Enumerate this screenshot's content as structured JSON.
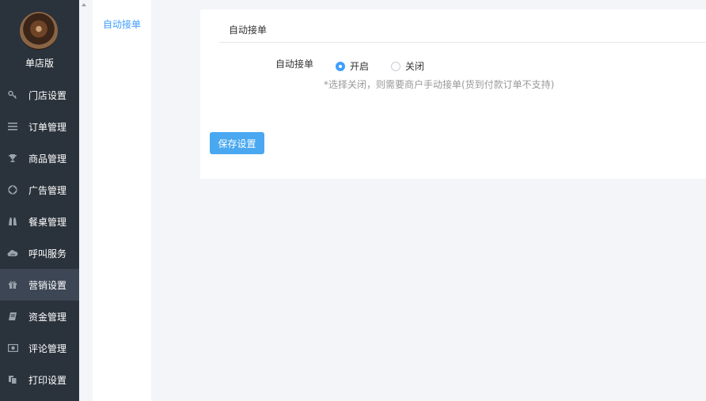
{
  "store": {
    "name": "单店版"
  },
  "nav": {
    "items": [
      {
        "label": "门店设置",
        "icon": "key-icon"
      },
      {
        "label": "订单管理",
        "icon": "list-icon"
      },
      {
        "label": "商品管理",
        "icon": "trophy-icon"
      },
      {
        "label": "广告管理",
        "icon": "lifebuoy-icon"
      },
      {
        "label": "餐桌管理",
        "icon": "binoculars-icon"
      },
      {
        "label": "呼叫服务",
        "icon": "cloud-icon"
      },
      {
        "label": "营销设置",
        "icon": "gift-icon",
        "active": true
      },
      {
        "label": "资金管理",
        "icon": "book-icon"
      },
      {
        "label": "评论管理",
        "icon": "money-icon"
      },
      {
        "label": "打印设置",
        "icon": "copy-icon"
      }
    ]
  },
  "subnav": {
    "active_label": "自动接单"
  },
  "panel": {
    "title": "自动接单",
    "field_label": "自动接单",
    "options": [
      {
        "label": "开启",
        "checked": true
      },
      {
        "label": "关闭",
        "checked": false
      }
    ],
    "hint": "*选择关闭，则需要商户手动接单(货到付款订单不支持)",
    "save_label": "保存设置"
  },
  "colors": {
    "accent": "#409eff",
    "sidebar_bg": "#2a323b",
    "sidebar_active": "#3c4654",
    "button": "#4aa8f0"
  }
}
